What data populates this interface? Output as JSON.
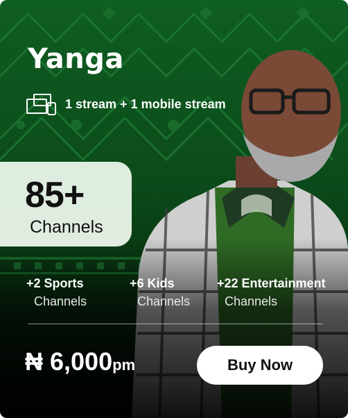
{
  "plan": {
    "name": "Yanga",
    "streams": "1 stream + 1 mobile stream",
    "channels": {
      "count": "85+",
      "label": "Channels"
    },
    "categories": [
      {
        "count": "+2 Sports",
        "label": "Channels"
      },
      {
        "count": "+6 Kids",
        "label": "Channels"
      },
      {
        "count": "+22 Entertainment",
        "label": "Channels"
      }
    ],
    "price": {
      "amount": "₦ 6,000",
      "period": "pm"
    },
    "cta": "Buy Now"
  },
  "icons": {
    "devices": "devices-icon"
  },
  "colors": {
    "background_green": "#0f5e22",
    "channels_box": "#e8f4e8",
    "text": "#ffffff",
    "button_bg": "#ffffff",
    "button_text": "#111111"
  }
}
